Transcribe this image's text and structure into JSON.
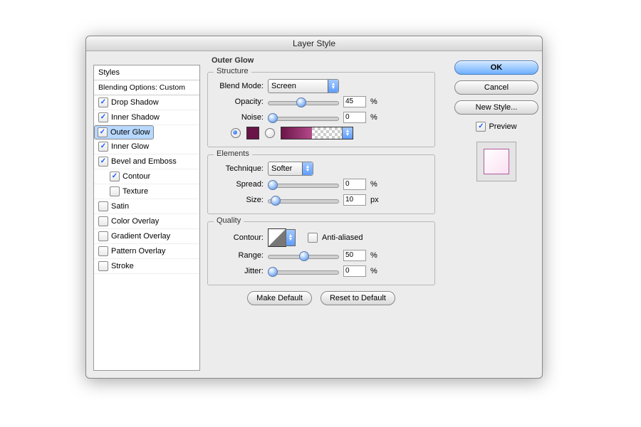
{
  "title": "Layer Style",
  "sidebar": {
    "header": "Styles",
    "subheader": "Blending Options: Custom",
    "items": [
      {
        "label": "Drop Shadow",
        "checked": true,
        "sub": false,
        "sel": false
      },
      {
        "label": "Inner Shadow",
        "checked": true,
        "sub": false,
        "sel": false
      },
      {
        "label": "Outer Glow",
        "checked": true,
        "sub": false,
        "sel": true
      },
      {
        "label": "Inner Glow",
        "checked": true,
        "sub": false,
        "sel": false
      },
      {
        "label": "Bevel and Emboss",
        "checked": true,
        "sub": false,
        "sel": false
      },
      {
        "label": "Contour",
        "checked": true,
        "sub": true,
        "sel": false
      },
      {
        "label": "Texture",
        "checked": false,
        "sub": true,
        "sel": false
      },
      {
        "label": "Satin",
        "checked": false,
        "sub": false,
        "sel": false
      },
      {
        "label": "Color Overlay",
        "checked": false,
        "sub": false,
        "sel": false
      },
      {
        "label": "Gradient Overlay",
        "checked": false,
        "sub": false,
        "sel": false
      },
      {
        "label": "Pattern Overlay",
        "checked": false,
        "sub": false,
        "sel": false
      },
      {
        "label": "Stroke",
        "checked": false,
        "sub": false,
        "sel": false
      }
    ]
  },
  "panel_title": "Outer Glow",
  "structure": {
    "title": "Structure",
    "blend_mode_label": "Blend Mode:",
    "blend_mode_value": "Screen",
    "opacity_label": "Opacity:",
    "opacity_value": "45",
    "opacity_pct": 45,
    "noise_label": "Noise:",
    "noise_value": "0",
    "noise_pct": 0,
    "percent": "%",
    "color": "#6a1548"
  },
  "elements": {
    "title": "Elements",
    "technique_label": "Technique:",
    "technique_value": "Softer",
    "spread_label": "Spread:",
    "spread_value": "0",
    "spread_pct": 0,
    "size_label": "Size:",
    "size_value": "10",
    "size_pct": 5,
    "percent": "%",
    "px": "px"
  },
  "quality": {
    "title": "Quality",
    "contour_label": "Contour:",
    "aa_label": "Anti-aliased",
    "range_label": "Range:",
    "range_value": "50",
    "range_pct": 50,
    "jitter_label": "Jitter:",
    "jitter_value": "0",
    "jitter_pct": 0,
    "percent": "%"
  },
  "buttons": {
    "ok": "OK",
    "cancel": "Cancel",
    "new_style": "New Style...",
    "preview": "Preview",
    "make_default": "Make Default",
    "reset_default": "Reset to Default"
  }
}
